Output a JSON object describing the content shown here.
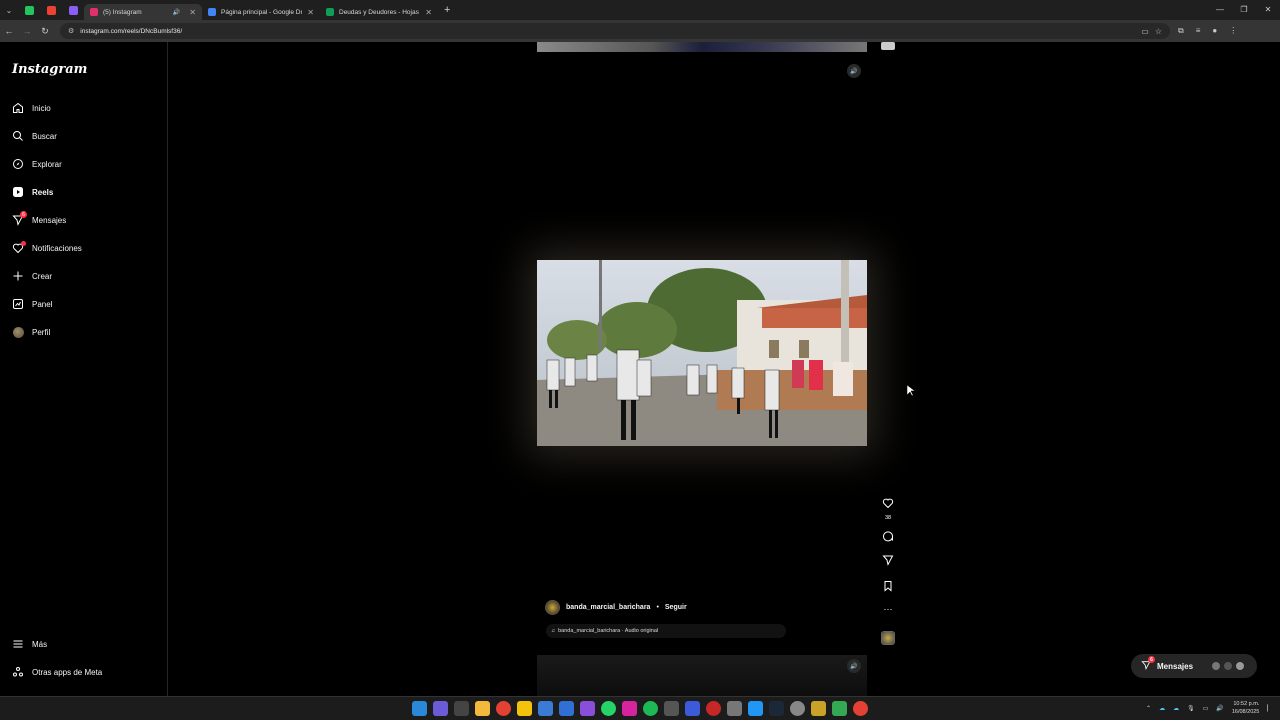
{
  "browser": {
    "tabs": [
      {
        "title": "(5) Instagram",
        "active": true,
        "favicon_color": "#e1306c"
      },
      {
        "title": "Página principal - Google Drive",
        "active": false,
        "favicon_color": "#4285f4"
      },
      {
        "title": "Deudas y Deudores - Hojas de",
        "active": false,
        "favicon_color": "#0f9d58"
      }
    ],
    "url": "instagram.com/reels/DNcBumlsf36/"
  },
  "sidebar": {
    "logo": "Instagram",
    "items": [
      {
        "label": "Inicio",
        "icon": "home-icon"
      },
      {
        "label": "Buscar",
        "icon": "search-icon"
      },
      {
        "label": "Explorar",
        "icon": "compass-icon"
      },
      {
        "label": "Reels",
        "icon": "reels-icon",
        "active": true
      },
      {
        "label": "Mensajes",
        "icon": "messenger-icon",
        "badge": "6"
      },
      {
        "label": "Notificaciones",
        "icon": "heart-icon"
      },
      {
        "label": "Crear",
        "icon": "plus-icon"
      },
      {
        "label": "Panel",
        "icon": "dashboard-icon"
      },
      {
        "label": "Perfil",
        "icon": "avatar"
      }
    ],
    "more": "Más",
    "meta_apps": "Otras apps de Meta"
  },
  "reel": {
    "likes": "38",
    "username": "banda_marcial_barichara",
    "follow": "Seguir",
    "separator": "•",
    "audio": "banda_marcial_barichara · Audio original"
  },
  "messages_pill": {
    "label": "Mensajes",
    "badge": "6"
  },
  "taskbar": {
    "time": "10:52 p.m.",
    "date": "16/08/2025"
  },
  "colors": {
    "accent_red": "#ff3040",
    "background": "#000000"
  }
}
